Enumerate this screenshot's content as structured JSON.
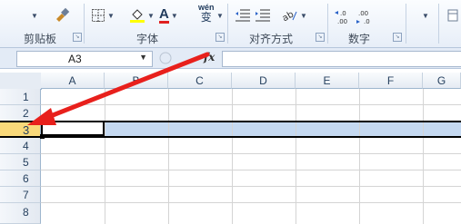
{
  "ribbon": {
    "clipboard_label": "剪贴板",
    "font_label": "字体",
    "align_label": "对齐方式",
    "number_label": "数字",
    "font_color_letter": "A",
    "wrap_text_glyph": "wén",
    "wrap_text_char": "变",
    "decimal_increase": "←.0\n.00",
    "decimal_decrease": ".00\n→.0"
  },
  "formula_bar": {
    "name_box": "A3",
    "fx_label": "fx",
    "formula_value": ""
  },
  "sheet": {
    "columns": [
      "A",
      "B",
      "C",
      "D",
      "E",
      "F",
      "G"
    ],
    "rows": [
      "1",
      "2",
      "3",
      "4",
      "5",
      "6",
      "7",
      "8"
    ],
    "selected_row": "3",
    "active_cell": "A3"
  },
  "colors": {
    "selection_fill": "#c5d9f1",
    "selected_header": "#f9d97a",
    "arrow": "#e8201c"
  }
}
